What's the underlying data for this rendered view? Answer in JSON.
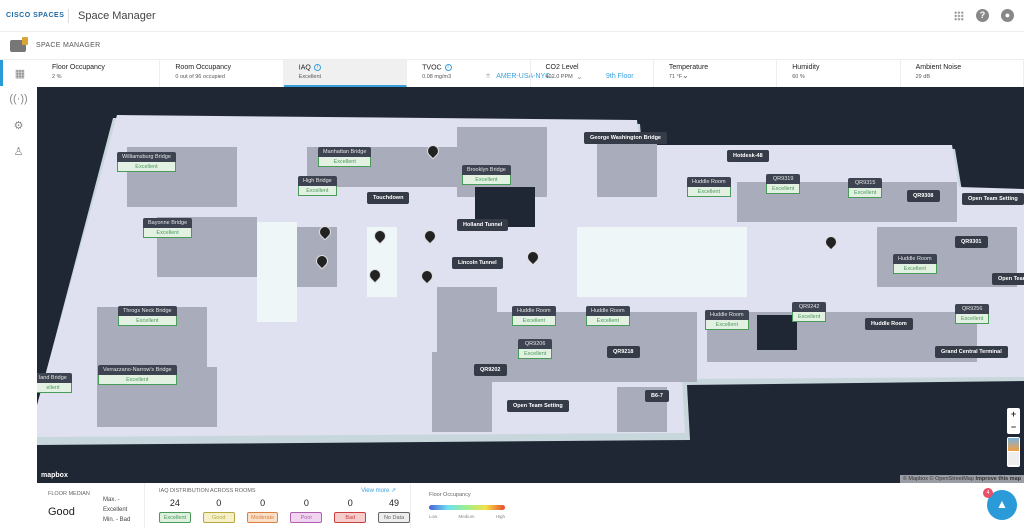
{
  "header": {
    "logo": "CISCO SPACES",
    "app_title": "Space Manager",
    "icons": [
      "apps-grid-icon",
      "help-icon",
      "user-icon"
    ]
  },
  "subheader": {
    "label": "SPACE MANAGER",
    "location": "AMER-USA-NYC...",
    "floor": "9th Floor"
  },
  "metrics": [
    {
      "title": "Floor Occupancy",
      "value": "2 %"
    },
    {
      "title": "Room Occupancy",
      "value": "0 out of 96 occupied"
    },
    {
      "title": "IAQ",
      "value": "Excellent",
      "info": true,
      "active": true
    },
    {
      "title": "TVOC",
      "value": "0.08 mg/m3",
      "info": true
    },
    {
      "title": "CO2 Level",
      "value": "402.0 PPM"
    },
    {
      "title": "Temperature",
      "value": "71 °F"
    },
    {
      "title": "Humidity",
      "value": "60 %"
    },
    {
      "title": "Ambient Noise",
      "value": "29 dB"
    }
  ],
  "map": {
    "labels": [
      {
        "name": "Williamsburg Bridge",
        "status": "Excellent"
      },
      {
        "name": "Manhattan Bridge",
        "status": "Excellent"
      },
      {
        "name": "High Bridge",
        "status": "Excellent"
      },
      {
        "name": "Brooklyn Bridge",
        "status": "Excellent"
      },
      {
        "name": "Bayonne Bridge",
        "status": "Excellent"
      },
      {
        "name": "Touchdown"
      },
      {
        "name": "Holland Tunnel"
      },
      {
        "name": "Lincoln Tunnel"
      },
      {
        "name": "George Washington Bridge"
      },
      {
        "name": "Hotdesk-48"
      },
      {
        "name": "Huddle Room",
        "status": "Excellent"
      },
      {
        "name": "QR9319",
        "status": "Excellent"
      },
      {
        "name": "QR9315",
        "status": "Excellent"
      },
      {
        "name": "QR9308"
      },
      {
        "name": "Open Team Setting"
      },
      {
        "name": "QR9301"
      },
      {
        "name": "Huddle Room",
        "status": "Excellent"
      },
      {
        "name": "Open Team"
      },
      {
        "name": "Throgs Neck Bridge",
        "status": "Excellent"
      },
      {
        "name": "Verrazzano-Narrow's Bridge",
        "status": "Excellent"
      },
      {
        "name": "land Bridge",
        "status": "ellent"
      },
      {
        "name": "Huddle Room",
        "status": "Excellent"
      },
      {
        "name": "Huddle Room",
        "status": "Excellent"
      },
      {
        "name": "QR9206",
        "status": "Excellent"
      },
      {
        "name": "QR9218"
      },
      {
        "name": "QR9202"
      },
      {
        "name": "Open Team Setting"
      },
      {
        "name": "B6-7"
      },
      {
        "name": "Huddle Room",
        "status": "Excellent"
      },
      {
        "name": "QR9242",
        "status": "Excellent"
      },
      {
        "name": "Huddle Room"
      },
      {
        "name": "QR9256",
        "status": "Excellent"
      },
      {
        "name": "Grand Central Terminal"
      }
    ],
    "mapbox_logo": "mapbox",
    "attribution": "© Mapbox © OpenStreetMap",
    "improve": "Improve this map",
    "zoom_in": "+",
    "zoom_out": "−"
  },
  "bottom": {
    "floor_median_label": "FLOOR MEDIAN",
    "floor_median": "Good",
    "max": "Max. - Excellent",
    "min": "Min. - Bad",
    "distribution_title": "IAQ DISTRIBUTION ACROSS ROOMS",
    "view_more": "View more",
    "distribution": [
      {
        "label": "Excellent",
        "count": "24",
        "color": "#4a9a5a",
        "bg": "#dff0e0"
      },
      {
        "label": "Good",
        "count": "0",
        "color": "#b8a840",
        "bg": "#f6f0c8"
      },
      {
        "label": "Moderate",
        "count": "0",
        "color": "#d98040",
        "bg": "#fbe0c8"
      },
      {
        "label": "Poor",
        "count": "0",
        "color": "#b060b0",
        "bg": "#f0d4f0"
      },
      {
        "label": "Bad",
        "count": "0",
        "color": "#c84040",
        "bg": "#f6cccc"
      },
      {
        "label": "No Data",
        "count": "49",
        "color": "#666666",
        "bg": "#eeeeee"
      }
    ],
    "occupancy_title": "Floor Occupancy",
    "legend": [
      "Low",
      "Medium",
      "High"
    ],
    "notification_count": "4"
  }
}
